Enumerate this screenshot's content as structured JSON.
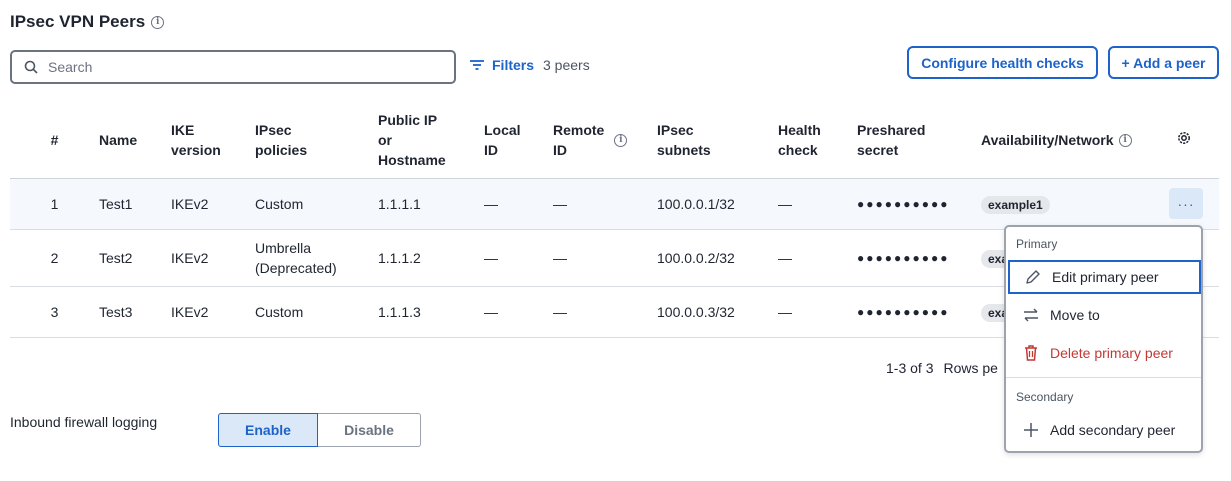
{
  "header": {
    "title": "IPsec VPN Peers",
    "info_glyph": "i"
  },
  "toolbar": {
    "search_placeholder": "Search",
    "filters_label": "Filters",
    "peer_count": "3 peers",
    "configure_health_label": "Configure health checks",
    "add_peer_label": "+ Add a peer"
  },
  "table": {
    "columns": {
      "num": "#",
      "name": "Name",
      "ike_line1": "IKE",
      "ike_line2": "version",
      "ipsec_pol_line1": "IPsec",
      "ipsec_pol_line2": "policies",
      "public_ip_line1": "Public IP",
      "public_ip_line2": "or",
      "public_ip_line3": "Hostname",
      "local_id_line1": "Local",
      "local_id_line2": "ID",
      "remote_id_line1": "Remote",
      "remote_id_line2": "ID",
      "ipsec_sub_line1": "IPsec",
      "ipsec_sub_line2": "subnets",
      "health_line1": "Health",
      "health_line2": "check",
      "secret_line1": "Preshared",
      "secret_line2": "secret",
      "availability": "Availability/Network"
    },
    "rows": [
      {
        "num": "1",
        "name": "Test1",
        "ike": "IKEv2",
        "policies_line1": "Custom",
        "policies_line2": "",
        "public_ip": "1.1.1.1",
        "local_id": "—",
        "remote_id": "—",
        "subnets": "100.0.0.1/32",
        "health": "—",
        "secret": "●●●●●●●●●●",
        "network": "example1"
      },
      {
        "num": "2",
        "name": "Test2",
        "ike": "IKEv2",
        "policies_line1": "Umbrella",
        "policies_line2": "(Deprecated)",
        "public_ip": "1.1.1.2",
        "local_id": "—",
        "remote_id": "—",
        "subnets": "100.0.0.2/32",
        "health": "—",
        "secret": "●●●●●●●●●●",
        "network": "exa"
      },
      {
        "num": "3",
        "name": "Test3",
        "ike": "IKEv2",
        "policies_line1": "Custom",
        "policies_line2": "",
        "public_ip": "1.1.1.3",
        "local_id": "—",
        "remote_id": "—",
        "subnets": "100.0.0.3/32",
        "health": "—",
        "secret": "●●●●●●●●●●",
        "network": "exa"
      }
    ],
    "more_label": "···"
  },
  "pagination": {
    "range": "1-3 of 3",
    "rows_per_page_label": "Rows pe"
  },
  "firewall": {
    "label": "Inbound firewall logging",
    "enable": "Enable",
    "disable": "Disable",
    "selected": "Enable"
  },
  "context_menu": {
    "primary_header": "Primary",
    "edit_primary": "Edit primary peer",
    "move_to": "Move to",
    "delete_primary": "Delete primary peer",
    "secondary_header": "Secondary",
    "add_secondary": "Add secondary peer"
  },
  "colors": {
    "accent": "#1d63c9",
    "danger": "#c23934",
    "chip_bg": "#e5e7eb",
    "row_highlight": "#f5f8fc"
  }
}
